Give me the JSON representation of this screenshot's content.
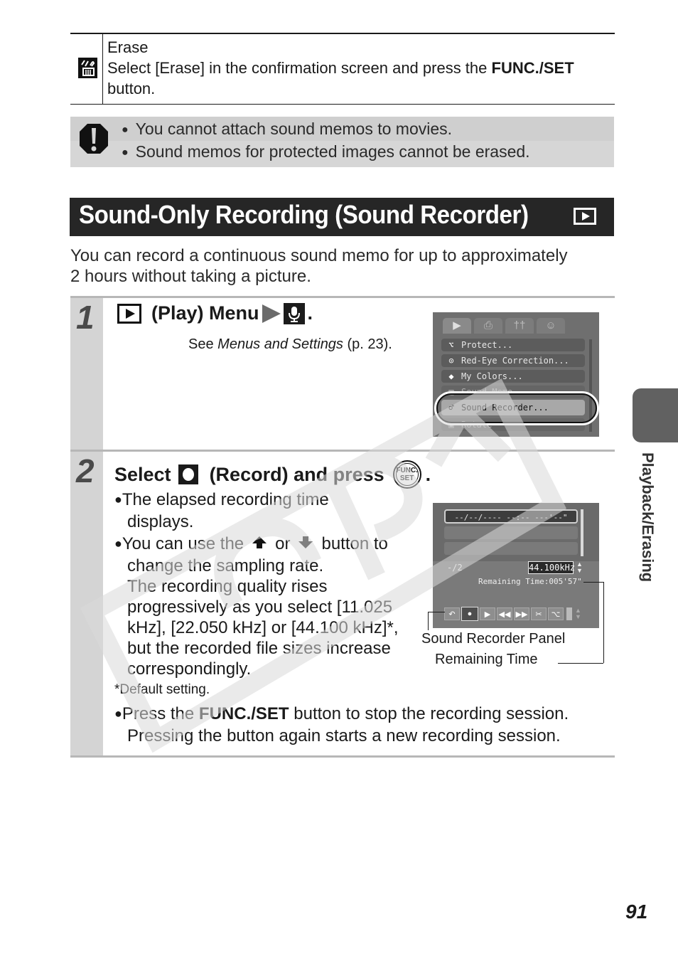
{
  "erase_row": {
    "icon": "erase-icon",
    "title": "Erase",
    "text_pre": "Select [Erase] in the confirmation screen and press the ",
    "text_bold": "FUNC./SET",
    "text_post": "button."
  },
  "caution": {
    "icon": "caution-icon",
    "items": [
      "You cannot attach sound memos to movies.",
      "Sound memos for protected images cannot be erased."
    ]
  },
  "section": {
    "title": "Sound-Only Recording (Sound Recorder)",
    "mode_icon": "playback-mode-icon",
    "intro_line1": "You can record a continuous sound memo for up to approximately",
    "intro_line2": "2 hours without taking a picture."
  },
  "step1": {
    "number": "1",
    "heading_text": "(Play) Menu",
    "heading_end": ".",
    "ref_pre": "See ",
    "ref_italic": "Menus and Settings",
    "ref_post": " (p. 23).",
    "screen": {
      "tabs": [
        "▶",
        "⎙",
        "††",
        "☺"
      ],
      "items": [
        {
          "icon": "⌥",
          "label": "Protect..."
        },
        {
          "icon": "⊙",
          "label": "Red-Eye Correction..."
        },
        {
          "icon": "◆",
          "label": "My Colors..."
        },
        {
          "icon": "▤",
          "label": "Sound Memo"
        },
        {
          "icon": "♂",
          "label": "Sound Recorder..."
        },
        {
          "icon": "▣",
          "label": "Rotate"
        }
      ],
      "selected_index": 4
    }
  },
  "step2": {
    "number": "2",
    "heading_pre": "Select",
    "heading_mid": "(Record) and press",
    "heading_end": ".",
    "func_label_1": "FUNC.",
    "func_label_2": "SET",
    "bullet1_line1": "The elapsed recording time",
    "bullet1_line2": "displays.",
    "bullet2_pre": "You can use the",
    "bullet2_or": "or",
    "bullet2_post": "button to",
    "bullet2_lines": [
      "change the sampling rate.",
      "The recording quality rises",
      "progressively as you select [11.025",
      "kHz], [22.050 kHz] or [44.100 kHz]*,",
      "but the recorded file sizes increase",
      "correspondingly."
    ],
    "footnote": "*Default setting.",
    "bullet3_pre": "Press the ",
    "bullet3_bold": "FUNC./SET",
    "bullet3_post": " button to stop the recording session.",
    "bullet3_line2": "Pressing the button again starts a new recording session.",
    "screen": {
      "date_row": "--/--/---- --:--  ---'--\"",
      "count": "-/2",
      "sampling_rate": "44.100kHz",
      "remaining": "Remaining Time:005'57\"",
      "controls": [
        "↶",
        "●",
        "▶",
        "◀◀",
        "▶▶",
        "✂",
        "⌥"
      ],
      "active_control_index": 1
    },
    "callout_panel": "Sound Recorder Panel",
    "callout_remaining": "Remaining Time"
  },
  "side_tab": {
    "label": "Playback/Erasing"
  },
  "watermark": "COPY",
  "page_number": "91"
}
